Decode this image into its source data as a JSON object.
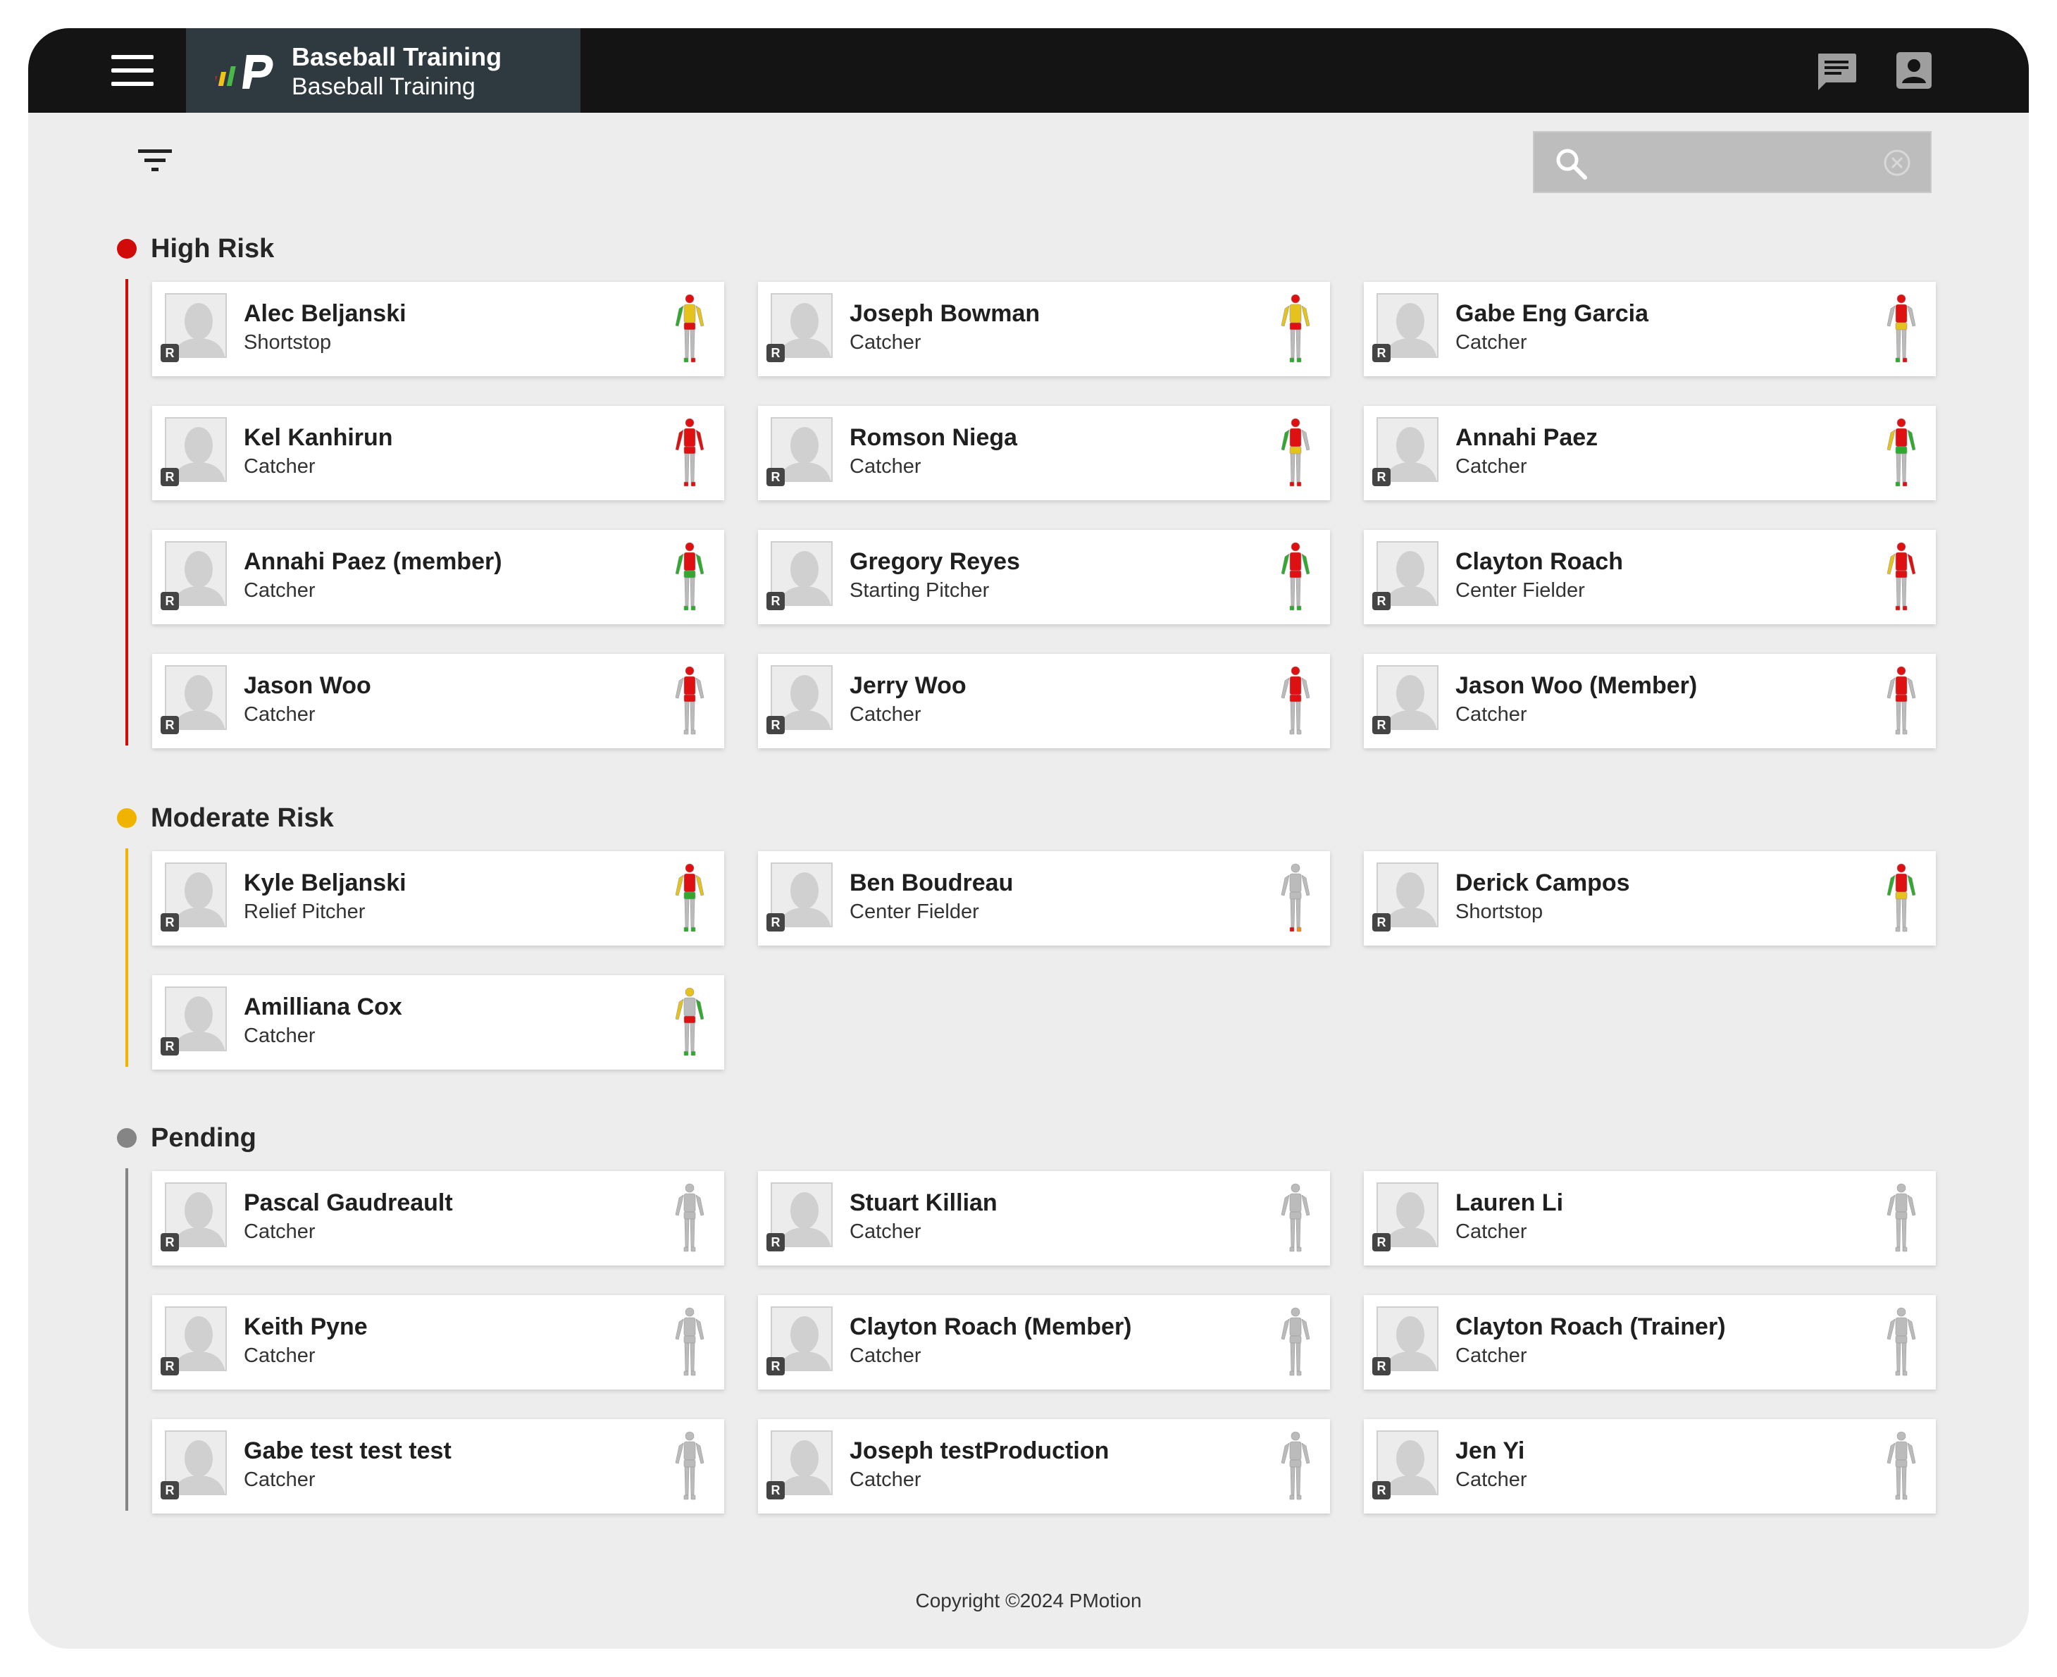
{
  "header": {
    "app_title": "Baseball Training",
    "app_subtitle": "Baseball Training",
    "menu_icon": "hamburger-menu-icon",
    "chat_icon": "chat-icon",
    "account_icon": "account-box-icon",
    "logo_colors": [
      "#e8262a",
      "#f2c21b",
      "#49b848",
      "#ffffff"
    ]
  },
  "toolbar": {
    "filter_icon": "filter-icon",
    "search": {
      "placeholder": "",
      "value": "",
      "icon": "search-icon",
      "clear_icon": "clear-circle-icon"
    }
  },
  "sections": [
    {
      "title": "High Risk",
      "color": "#d10a0a",
      "players": [
        {
          "name": "Alec Beljanski",
          "position": "Shortstop",
          "badge": "R",
          "map": {
            "head": "#d11",
            "torso": "#e6c21d",
            "l_arm": "#2faa2f",
            "r_arm": "#e6c21d",
            "hips": "#d11",
            "legs": "#bbb",
            "l_foot": "#2faa2f",
            "r_foot": "#d11"
          }
        },
        {
          "name": "Joseph Bowman",
          "position": "Catcher",
          "badge": "R",
          "map": {
            "head": "#d11",
            "torso": "#e6c21d",
            "l_arm": "#e6c21d",
            "r_arm": "#e6c21d",
            "hips": "#d11",
            "legs": "#bbb",
            "l_foot": "#2faa2f",
            "r_foot": "#2faa2f"
          }
        },
        {
          "name": "Gabe Eng Garcia",
          "position": "Catcher",
          "badge": "R",
          "map": {
            "head": "#d11",
            "torso": "#d11",
            "l_arm": "#bbb",
            "r_arm": "#bbb",
            "hips": "#e6c21d",
            "legs": "#bbb",
            "l_foot": "#2faa2f",
            "r_foot": "#d11"
          }
        },
        {
          "name": "Kel Kanhirun",
          "position": "Catcher",
          "badge": "R",
          "map": {
            "head": "#d11",
            "torso": "#d11",
            "l_arm": "#d11",
            "r_arm": "#d11",
            "hips": "#d11",
            "legs": "#bbb",
            "l_foot": "#d11",
            "r_foot": "#d11"
          }
        },
        {
          "name": "Romson Niega",
          "position": "Catcher",
          "badge": "R",
          "map": {
            "head": "#d11",
            "torso": "#d11",
            "l_arm": "#2faa2f",
            "r_arm": "#bbb",
            "hips": "#e6c21d",
            "legs": "#bbb",
            "l_foot": "#d11",
            "r_foot": "#d11"
          }
        },
        {
          "name": "Annahi Paez",
          "position": "Catcher",
          "badge": "R",
          "map": {
            "head": "#d11",
            "torso": "#d11",
            "l_arm": "#e6c21d",
            "r_arm": "#2faa2f",
            "hips": "#2faa2f",
            "legs": "#bbb",
            "l_foot": "#2faa2f",
            "r_foot": "#d11"
          }
        },
        {
          "name": "Annahi Paez (member)",
          "position": "Catcher",
          "badge": "R",
          "map": {
            "head": "#d11",
            "torso": "#d11",
            "l_arm": "#2faa2f",
            "r_arm": "#2faa2f",
            "hips": "#2faa2f",
            "legs": "#bbb",
            "l_foot": "#2faa2f",
            "r_foot": "#2faa2f"
          }
        },
        {
          "name": "Gregory Reyes",
          "position": "Starting Pitcher",
          "badge": "R",
          "map": {
            "head": "#d11",
            "torso": "#d11",
            "l_arm": "#2faa2f",
            "r_arm": "#2faa2f",
            "hips": "#d11",
            "legs": "#bbb",
            "l_foot": "#2faa2f",
            "r_foot": "#2faa2f"
          }
        },
        {
          "name": "Clayton Roach",
          "position": "Center Fielder",
          "badge": "R",
          "map": {
            "head": "#d11",
            "torso": "#d11",
            "l_arm": "#e6c21d",
            "r_arm": "#d11",
            "hips": "#d11",
            "legs": "#bbb",
            "l_foot": "#d11",
            "r_foot": "#d11"
          }
        },
        {
          "name": "Jason Woo",
          "position": "Catcher",
          "badge": "R",
          "map": {
            "head": "#d11",
            "torso": "#d11",
            "l_arm": "#bbb",
            "r_arm": "#bbb",
            "hips": "#d11",
            "legs": "#bbb",
            "l_foot": "#bbb",
            "r_foot": "#bbb"
          }
        },
        {
          "name": "Jerry Woo",
          "position": "Catcher",
          "badge": "R",
          "map": {
            "head": "#d11",
            "torso": "#d11",
            "l_arm": "#bbb",
            "r_arm": "#bbb",
            "hips": "#d11",
            "legs": "#bbb",
            "l_foot": "#bbb",
            "r_foot": "#bbb"
          }
        },
        {
          "name": "Jason Woo (Member)",
          "position": "Catcher",
          "badge": "R",
          "map": {
            "head": "#d11",
            "torso": "#d11",
            "l_arm": "#bbb",
            "r_arm": "#bbb",
            "hips": "#d11",
            "legs": "#bbb",
            "l_foot": "#bbb",
            "r_foot": "#bbb"
          }
        }
      ]
    },
    {
      "title": "Moderate Risk",
      "color": "#f0b400",
      "players": [
        {
          "name": "Kyle Beljanski",
          "position": "Relief Pitcher",
          "badge": "R",
          "map": {
            "head": "#d11",
            "torso": "#d11",
            "l_arm": "#e6c21d",
            "r_arm": "#e6c21d",
            "hips": "#2faa2f",
            "legs": "#bbb",
            "l_foot": "#2faa2f",
            "r_foot": "#2faa2f"
          }
        },
        {
          "name": "Ben Boudreau",
          "position": "Center Fielder",
          "badge": "R",
          "map": {
            "head": "#bbb",
            "torso": "#bbb",
            "l_arm": "#bbb",
            "r_arm": "#bbb",
            "hips": "#bbb",
            "legs": "#bbb",
            "l_foot": "#d11",
            "r_foot": "#f08a1c"
          }
        },
        {
          "name": "Derick Campos",
          "position": "Shortstop",
          "badge": "R",
          "map": {
            "head": "#d11",
            "torso": "#d11",
            "l_arm": "#2faa2f",
            "r_arm": "#2faa2f",
            "hips": "#e6c21d",
            "legs": "#bbb",
            "l_foot": "#bbb",
            "r_foot": "#bbb"
          }
        },
        {
          "name": "Amilliana Cox",
          "position": "Catcher",
          "badge": "R",
          "map": {
            "head": "#e6c21d",
            "torso": "#bbb",
            "l_arm": "#e6c21d",
            "r_arm": "#2faa2f",
            "hips": "#d11",
            "legs": "#bbb",
            "l_foot": "#2faa2f",
            "r_foot": "#2faa2f"
          }
        }
      ]
    },
    {
      "title": "Pending",
      "color": "#858585",
      "players": [
        {
          "name": "Pascal Gaudreault",
          "position": "Catcher",
          "badge": "R",
          "map": {
            "head": "#bbb",
            "torso": "#bbb",
            "l_arm": "#bbb",
            "r_arm": "#bbb",
            "hips": "#bbb",
            "legs": "#bbb",
            "l_foot": "#bbb",
            "r_foot": "#bbb"
          }
        },
        {
          "name": "Stuart Killian",
          "position": "Catcher",
          "badge": "R",
          "map": {
            "head": "#bbb",
            "torso": "#bbb",
            "l_arm": "#bbb",
            "r_arm": "#bbb",
            "hips": "#bbb",
            "legs": "#bbb",
            "l_foot": "#bbb",
            "r_foot": "#bbb"
          }
        },
        {
          "name": "Lauren Li",
          "position": "Catcher",
          "badge": "R",
          "map": {
            "head": "#bbb",
            "torso": "#bbb",
            "l_arm": "#bbb",
            "r_arm": "#bbb",
            "hips": "#bbb",
            "legs": "#bbb",
            "l_foot": "#bbb",
            "r_foot": "#bbb"
          }
        },
        {
          "name": "Keith Pyne",
          "position": "Catcher",
          "badge": "R",
          "map": {
            "head": "#bbb",
            "torso": "#bbb",
            "l_arm": "#bbb",
            "r_arm": "#bbb",
            "hips": "#bbb",
            "legs": "#bbb",
            "l_foot": "#bbb",
            "r_foot": "#bbb"
          }
        },
        {
          "name": "Clayton Roach (Member)",
          "position": "Catcher",
          "badge": "R",
          "map": {
            "head": "#bbb",
            "torso": "#bbb",
            "l_arm": "#bbb",
            "r_arm": "#bbb",
            "hips": "#bbb",
            "legs": "#bbb",
            "l_foot": "#bbb",
            "r_foot": "#bbb"
          }
        },
        {
          "name": "Clayton Roach (Trainer)",
          "position": "Catcher",
          "badge": "R",
          "map": {
            "head": "#bbb",
            "torso": "#bbb",
            "l_arm": "#bbb",
            "r_arm": "#bbb",
            "hips": "#bbb",
            "legs": "#bbb",
            "l_foot": "#bbb",
            "r_foot": "#bbb"
          }
        },
        {
          "name": "Gabe test test test",
          "position": "Catcher",
          "badge": "R",
          "map": {
            "head": "#bbb",
            "torso": "#bbb",
            "l_arm": "#bbb",
            "r_arm": "#bbb",
            "hips": "#bbb",
            "legs": "#bbb",
            "l_foot": "#bbb",
            "r_foot": "#bbb"
          }
        },
        {
          "name": "Joseph testProduction",
          "position": "Catcher",
          "badge": "R",
          "map": {
            "head": "#bbb",
            "torso": "#bbb",
            "l_arm": "#bbb",
            "r_arm": "#bbb",
            "hips": "#bbb",
            "legs": "#bbb",
            "l_foot": "#bbb",
            "r_foot": "#bbb"
          }
        },
        {
          "name": "Jen Yi",
          "position": "Catcher",
          "badge": "R",
          "map": {
            "head": "#bbb",
            "torso": "#bbb",
            "l_arm": "#bbb",
            "r_arm": "#bbb",
            "hips": "#bbb",
            "legs": "#bbb",
            "l_foot": "#bbb",
            "r_foot": "#bbb"
          }
        }
      ]
    }
  ],
  "footer": {
    "copyright": "Copyright ©2024 PMotion"
  }
}
